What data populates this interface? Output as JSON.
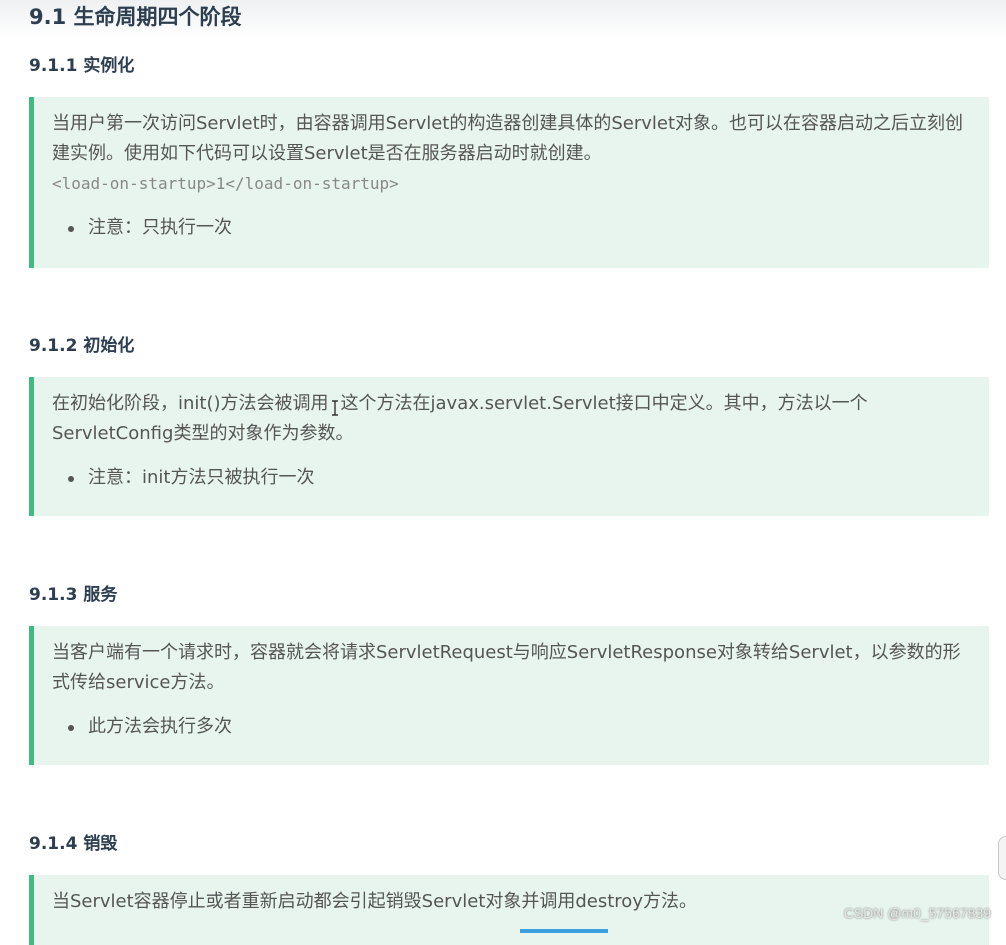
{
  "section": {
    "title": "9.1 生命周期四个阶段"
  },
  "phases": [
    {
      "heading": "9.1.1 实例化",
      "text": "当用户第一次访问Servlet时，由容器调用Servlet的构造器创建具体的Servlet对象。也可以在容器启动之后立刻创建实例。使用如下代码可以设置Servlet是否在服务器启动时就创建。",
      "code": "<load-on-startup>1</load-on-startup>",
      "note": "注意：只执行一次"
    },
    {
      "heading": "9.1.2 初始化",
      "text_before_cursor": "在初始化阶段，init()方法会被调用",
      "text_after_cursor": "这个方法在javax.servlet.Servlet接口中定义。其中，方法以一个ServletConfig类型的对象作为参数。",
      "note": "注意：init方法只被执行一次"
    },
    {
      "heading": "9.1.3 服务",
      "text": "当客户端有一个请求时，容器就会将请求ServletRequest与响应ServletResponse对象转给Servlet，以参数的形式传给service方法。",
      "note": "此方法会执行多次"
    },
    {
      "heading": "9.1.4 销毁",
      "text": "当Servlet容器停止或者重新启动都会引起销毁Servlet对象并调用destroy方法。"
    }
  ],
  "watermark": "CSDN @m0_57567839",
  "colors": {
    "accent": "#42b983",
    "quote_bg": "#e8f5ef",
    "heading": "#2c3e50"
  }
}
